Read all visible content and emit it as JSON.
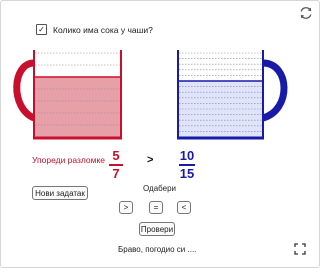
{
  "question": {
    "label": "Колико има сока у чаши?",
    "checked": true
  },
  "instruction": "Упореди разломке",
  "fractions": {
    "left": {
      "numerator": "5",
      "denominator": "7"
    },
    "right": {
      "numerator": "10",
      "denominator": "15"
    }
  },
  "comparison_sign": ">",
  "new_task_label": "Нови задатак",
  "choose_label": "Одабери",
  "choices": [
    ">",
    "=",
    "<"
  ],
  "check_label": "Провери",
  "message": "Браво, погодио си ....",
  "cups": {
    "left": {
      "color": "#c8102e",
      "fill_color": "#e8a0a8",
      "parts": 7,
      "filled": 5
    },
    "right": {
      "color": "#1a1aa8",
      "fill_color": "#dfe3fb",
      "parts": 15,
      "filled": 10
    }
  },
  "icons": {
    "reset": "reset-icon",
    "fullscreen": "fullscreen-icon"
  }
}
